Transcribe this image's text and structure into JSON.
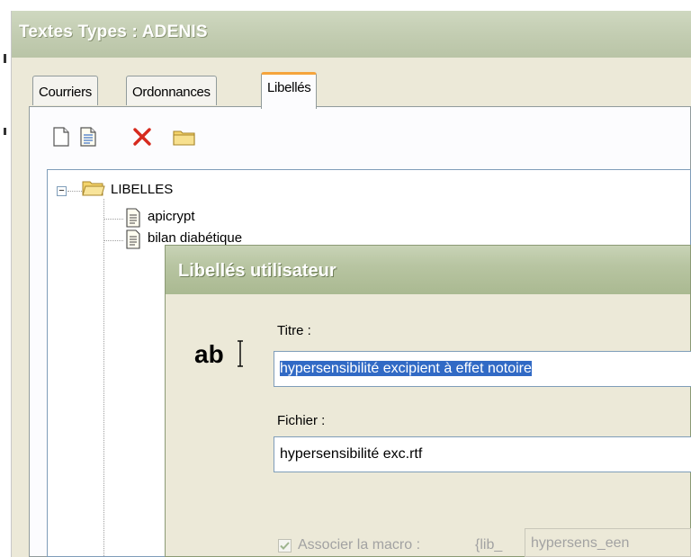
{
  "main_window": {
    "title": "Textes Types : ADENIS"
  },
  "tabs": [
    {
      "label": "Courriers",
      "active": false
    },
    {
      "label": "Ordonnances",
      "active": false
    },
    {
      "label": "Libellés",
      "active": true
    }
  ],
  "toolbar": {
    "icons": [
      "new-document-icon",
      "document-icon",
      "delete-icon",
      "folder-icon"
    ]
  },
  "tree": {
    "root": {
      "label": "LIBELLES",
      "expander": "−"
    },
    "items": [
      "apicrypt",
      "bilan diabétique"
    ]
  },
  "dialog": {
    "title": "Libellés utilisateur",
    "icon_text": "ab",
    "titre_label": "Titre :",
    "titre_value": "hypersensibilité excipient à effet notoire",
    "fichier_label": "Fichier :",
    "fichier_value": "hypersensibilité exc.rtf",
    "macro_label": "Associer la macro :",
    "macro_prefix": "{lib_",
    "macro_value": "hypersens_een",
    "macro_checked": true
  },
  "colors": {
    "title_text": "#ffffff",
    "selection": "#316ac5",
    "active_tab_accent": "#f5a43c"
  }
}
